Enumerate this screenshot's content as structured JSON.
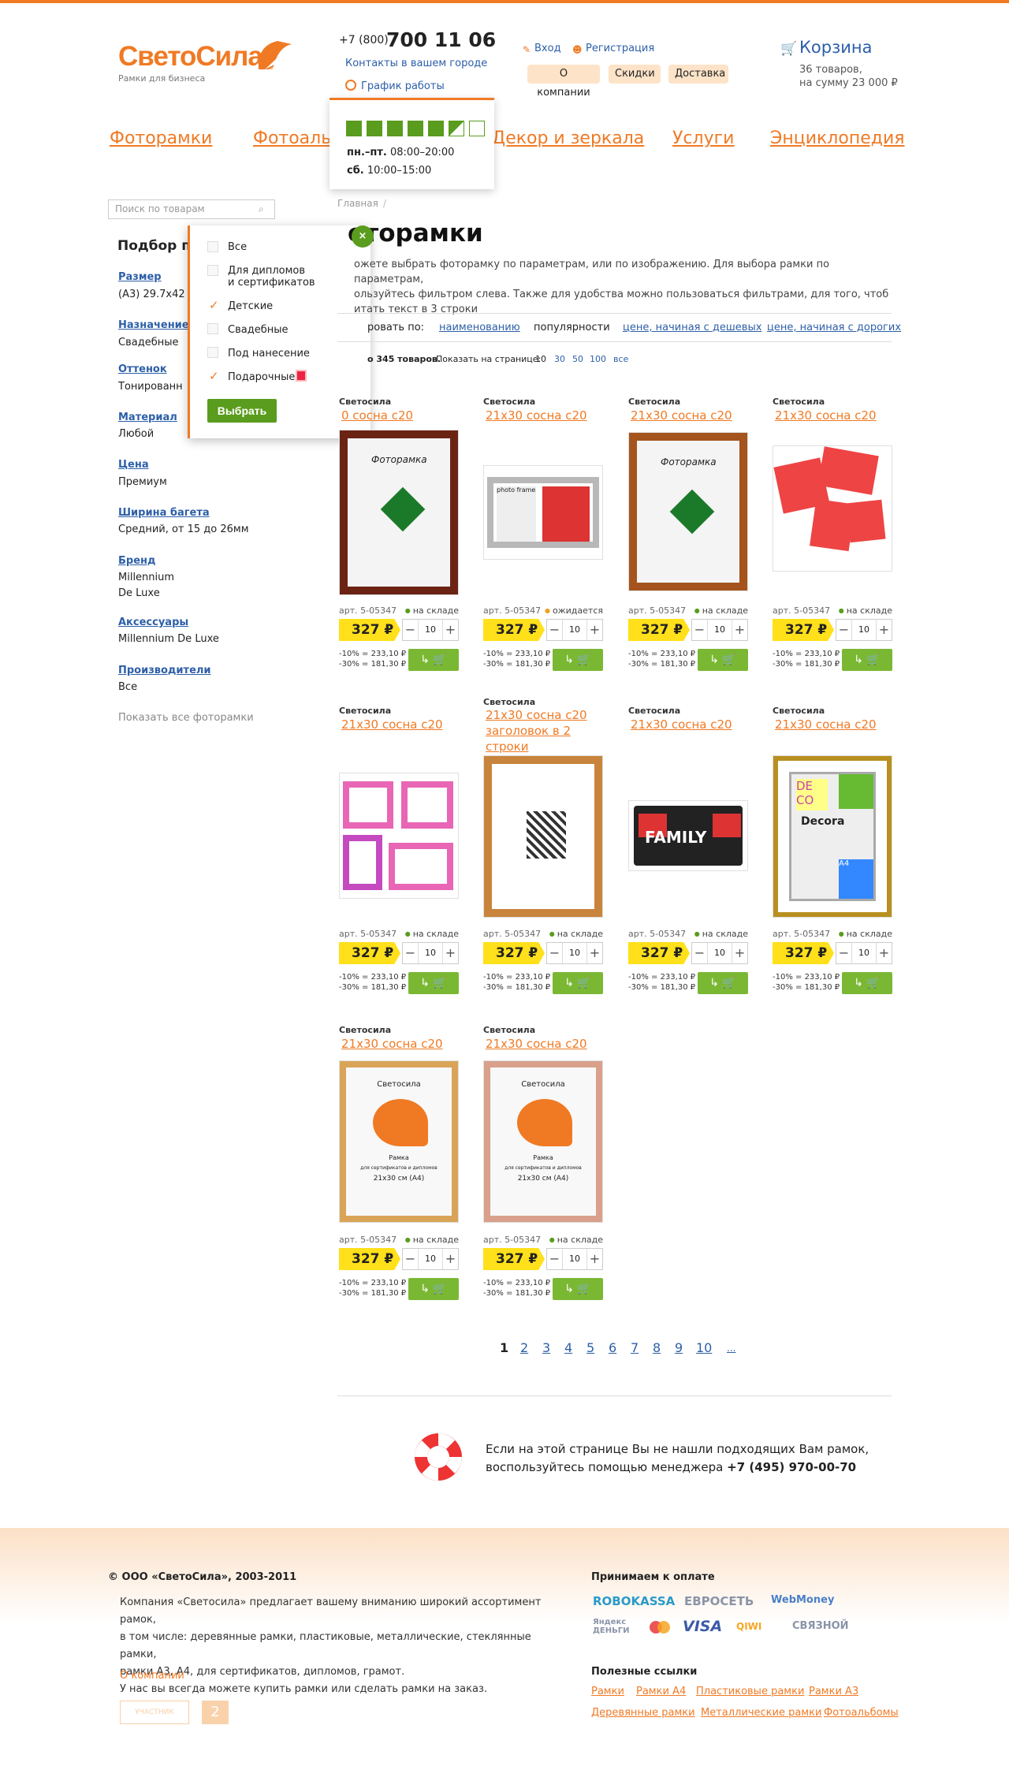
{
  "header": {
    "logo": "СветоСила",
    "logo_sub": "Рамки для бизнеса",
    "phone_prefix": "+7 (800)",
    "phone_main": "700 11 06",
    "contacts_link": "Контакты в вашем городе",
    "schedule_link": "График работы",
    "login": "Вход",
    "register": "Регистрация",
    "pills": [
      "О компании",
      "Скидки",
      "Доставка"
    ],
    "cart_label": "Корзина",
    "cart_count": "36 товаров,",
    "cart_sum": "на сумму 23 000 ₽"
  },
  "schedule_popup": {
    "weekdays_label": "пн.–пт.",
    "weekdays_time": "08:00–20:00",
    "sat_label": "сб.",
    "sat_time": "10:00–15:00"
  },
  "nav": [
    "Фоторамки",
    "Фотоальбомы",
    "Декор и зеркала",
    "Услуги",
    "Энциклопедия"
  ],
  "search": {
    "placeholder": "Поиск по товарам"
  },
  "filter": {
    "title": "Подбор по",
    "groups": [
      {
        "caption": "Размер",
        "value": "(А3)  29.7x42"
      },
      {
        "caption": "Назначение",
        "value": "Свадебные"
      },
      {
        "caption": "Оттенок",
        "value": "Тонированн"
      },
      {
        "caption": "Материал",
        "value": "Любой"
      },
      {
        "caption": "Цена",
        "value": "Премиум"
      },
      {
        "caption": "Ширина багета",
        "value": "Средний, от 15 до 26мм"
      },
      {
        "caption": "Бренд",
        "value": "Millennium\nDe Luxe"
      },
      {
        "caption": "Аксессуары",
        "value": "Millennium De Luxe"
      },
      {
        "caption": "Производители",
        "value": "Все"
      }
    ],
    "show_all": "Показать все фоторамки"
  },
  "popup": {
    "options": [
      {
        "label": "Все",
        "checked": false
      },
      {
        "label": "Для дипломов\nи сертификатов",
        "checked": false
      },
      {
        "label": "Детские",
        "checked": true
      },
      {
        "label": "Свадебные",
        "checked": false
      },
      {
        "label": "Под нанесение",
        "checked": false
      },
      {
        "label": "Подарочные",
        "checked": true
      }
    ],
    "button": "Выбрать"
  },
  "breadcrumb": "Главная",
  "page_title": "оторамки",
  "intro": "ожете выбрать фоторамку по параметрам, или по изображению. Для выбора рамки по параметрам,\nользуйтесь фильтром слева. Также для удобства можно пользоваться фильтрами, для того, чтоб\nитать текст в 3 строки",
  "sort": {
    "label": "ровать по:",
    "by_name": "наименованию",
    "by_pop": "популярности",
    "by_price_asc": "цене, начиная с дешевых",
    "by_price_desc": "цене, начиная с дорогих"
  },
  "perpage": {
    "found": "о 345 товаров.",
    "label": "Показать на странице:",
    "current": "10",
    "options": [
      "30",
      "50",
      "100",
      "все"
    ]
  },
  "product_defaults": {
    "brand": "Светосила",
    "article": "арт. 5-05347",
    "price": "327 ₽",
    "qty": "10",
    "disc1": "-10% = 233,10 ₽",
    "disc2": "-30% = 181,30 ₽",
    "in_stock": "на складе",
    "expected": "ожидается"
  },
  "products": [
    {
      "title": "0 сосна с20",
      "stock": "на складе"
    },
    {
      "title": "21x30 сосна с20",
      "stock": "ожидается"
    },
    {
      "title": "21x30 сосна с20",
      "stock": "на складе"
    },
    {
      "title": "21x30 сосна с20",
      "stock": "на складе"
    },
    {
      "title": "21x30 сосна с20",
      "stock": "на складе"
    },
    {
      "title": "21x30 сосна с20 заголовок в 2 строки",
      "stock": "на складе"
    },
    {
      "title": "21x30 сосна с20",
      "stock": "на складе"
    },
    {
      "title": "21x30 сосна с20",
      "stock": "на складе"
    },
    {
      "title": "21x30 сосна с20",
      "stock": "на складе"
    },
    {
      "title": "21x30 сосна с20",
      "stock": "на складе"
    }
  ],
  "product_image_text": {
    "fotoramka": "Фоторамка",
    "photo_frame": "photo frame",
    "family": "FAMILY",
    "decora": "Decora",
    "deco": "DE CO",
    "a4": "A4",
    "svetosila": "Светосила",
    "ramka": "Рамка",
    "ramka_sub": "для сертификатов и дипломов",
    "size_a4": "21x30 см (А4)"
  },
  "pager": [
    "1",
    "2",
    "3",
    "4",
    "5",
    "6",
    "7",
    "8",
    "9",
    "10",
    "..."
  ],
  "help": {
    "line1": "Если на этой странице Вы не нашли подходящих Вам рамок,",
    "line2": "воспользуйтесь помощью менеджера",
    "phone": "+7 (495) 970-00-70"
  },
  "footer": {
    "copyright": "© ООО «СветоСила», 2003-2011",
    "about": "Компания «Светосила» предлагает вашему вниманию широкий ассортимент рамок,\nв том числе: деревянные рамки, пластиковые, металлические, стеклянные рамки,\nрамки А3, А4, для сертификатов, дипломов, грамот.\nУ нас вы всегда можете купить рамки или сделать рамки на заказ.",
    "about_link": "О компании",
    "badge": "УЧАСТНИК",
    "pay_title": "Принимаем к оплате",
    "pay_logos": [
      "ROBOKASSA",
      "ЕВРОСЕТЬ",
      "WebMoney",
      "Яндекс ДЕНЬГИ",
      "MasterCard",
      "VISA",
      "QIWI",
      "СВЯЗНОЙ"
    ],
    "links_title": "Полезные ссылки",
    "links": [
      "Рамки",
      "Рамки А4",
      "Пластиковые рамки",
      "Рамки А3",
      "Деревянные рамки",
      "Металлические рамки",
      "Фотоальбомы"
    ]
  },
  "colors": {
    "accent": "#f07a24",
    "link": "#2d5fa8",
    "price": "#ffe01a",
    "green": "#5a9c1e"
  }
}
